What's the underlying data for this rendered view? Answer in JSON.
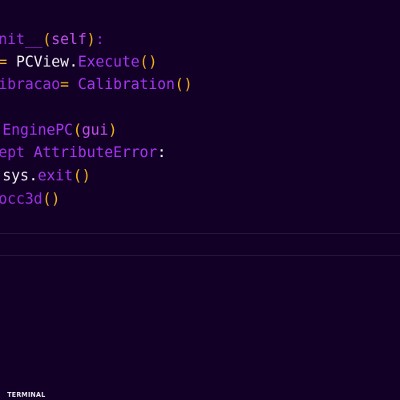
{
  "editor": {
    "lines": [
      {
        "tokens": [
          {
            "t": "nit__",
            "c": "tok-kw"
          },
          {
            "t": "(",
            "c": "tok-punc"
          },
          {
            "t": "self",
            "c": "tok-self"
          },
          {
            "t": ")",
            "c": "tok-punc"
          },
          {
            "t": ":",
            "c": "tok-kw"
          }
        ]
      },
      {
        "tokens": [
          {
            "t": "= ",
            "c": "tok-op"
          },
          {
            "t": "PCView",
            "c": "tok-plain"
          },
          {
            "t": ".",
            "c": "tok-plain"
          },
          {
            "t": "Execute",
            "c": "tok-fn"
          },
          {
            "t": "()",
            "c": "tok-punc"
          }
        ]
      },
      {
        "tokens": [
          {
            "t": "ibracao",
            "c": "tok-dim"
          },
          {
            "t": "= ",
            "c": "tok-op"
          },
          {
            "t": "Calibration",
            "c": "tok-cls"
          },
          {
            "t": "()",
            "c": "tok-punc"
          }
        ]
      },
      {
        "tokens": []
      },
      {
        "tokens": [
          {
            "t": " EnginePC",
            "c": "tok-cls"
          },
          {
            "t": "(",
            "c": "tok-punc"
          },
          {
            "t": "gui",
            "c": "tok-self"
          },
          {
            "t": ")",
            "c": "tok-punc"
          }
        ]
      },
      {
        "tokens": [
          {
            "t": "ept ",
            "c": "tok-kw"
          },
          {
            "t": "AttributeError",
            "c": "tok-cls"
          },
          {
            "t": ":",
            "c": "tok-plain"
          }
        ]
      },
      {
        "tokens": [
          {
            "t": " sys",
            "c": "tok-plain"
          },
          {
            "t": ".",
            "c": "tok-plain"
          },
          {
            "t": "exit",
            "c": "tok-fn"
          },
          {
            "t": "()",
            "c": "tok-punc"
          }
        ]
      },
      {
        "tokens": [
          {
            "t": "occ3d",
            "c": "tok-kw"
          },
          {
            "t": "()",
            "c": "tok-punc"
          }
        ]
      }
    ]
  },
  "panel": {
    "terminal_label": "TERMINAL"
  },
  "colors": {
    "background": "#130027",
    "keyword": "#9b2fe0",
    "punctuation": "#f2b21b",
    "identifier": "#f2f0f5",
    "class_name": "#a535f0",
    "divider": "#2b1840"
  }
}
